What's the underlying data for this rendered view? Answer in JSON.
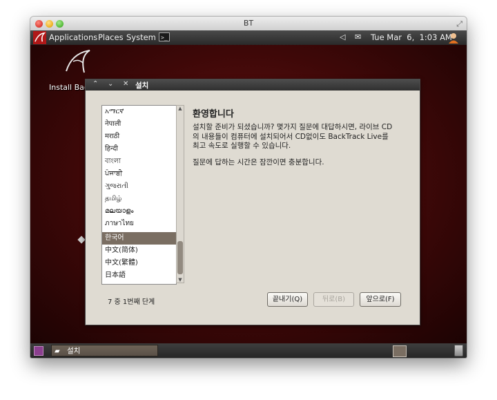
{
  "window": {
    "title": "BT"
  },
  "top_panel": {
    "menus": [
      "Applications",
      "Places",
      "System"
    ],
    "terminal_glyph": ">_",
    "clock": "Tue Mar  6,  1:03 AM"
  },
  "desktop": {
    "launcher_label": "Install Bac"
  },
  "dialog": {
    "title": "설치",
    "languages": [
      "አማርኛ",
      "नेपाली",
      "मराठी",
      "हिन्दी",
      "বাংলা",
      "ਪੰਜਾਬੀ",
      "ગુજરાતી",
      "தமிழ்",
      "മലയാളം",
      "ภาษาไทย",
      "한국어",
      "中文(简体)",
      "中文(繁體)",
      "日本語"
    ],
    "selected_index": 10,
    "heading": "환영합니다",
    "body_lines": [
      "설치할 준비가 되셨습니까? 몇가지 질문에 대답하시면, 라이브 CD",
      "의 내용들이 컴퓨터에 설치되어서 CD없이도 BackTrack Live를",
      "최고 속도로 실행할 수 있습니다."
    ],
    "note": "질문에 답하는 시간은 잠깐이면 충분합니다.",
    "step": "7 중 1번째 단계",
    "buttons": {
      "quit": "끝내기(Q)",
      "back": "뒤로(B)",
      "forward": "앞으로(F)"
    }
  },
  "bottom_panel": {
    "task_label": "설치"
  }
}
